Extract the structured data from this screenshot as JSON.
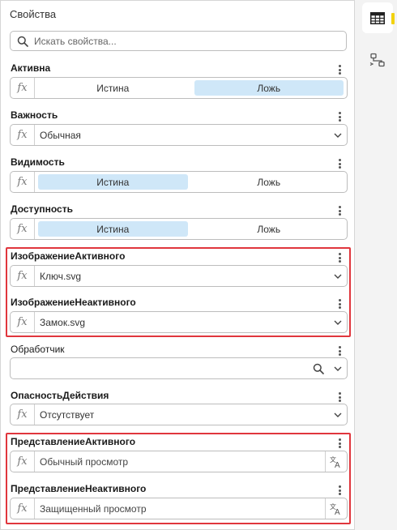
{
  "panel": {
    "title": "Свойства",
    "search_placeholder": "Искать свойства..."
  },
  "props": {
    "active": {
      "label": "Активна",
      "options": [
        "Истина",
        "Ложь"
      ],
      "selected": "Ложь"
    },
    "importance": {
      "label": "Важность",
      "value": "Обычная"
    },
    "visibility": {
      "label": "Видимость",
      "options": [
        "Истина",
        "Ложь"
      ],
      "selected": "Истина"
    },
    "accessibility": {
      "label": "Доступность",
      "options": [
        "Истина",
        "Ложь"
      ],
      "selected": "Истина"
    },
    "active_image": {
      "label": "ИзображениеАктивного",
      "value": "Ключ.svg"
    },
    "inactive_image": {
      "label": "ИзображениеНеактивного",
      "value": "Замок.svg"
    },
    "handler": {
      "label": "Обработчик",
      "value": ""
    },
    "action_danger": {
      "label": "ОпасностьДействия",
      "value": "Отсутствует"
    },
    "active_view": {
      "label": "ПредставлениеАктивного",
      "value": "Обычный просмотр"
    },
    "inactive_view": {
      "label": "ПредставлениеНеактивного",
      "value": "Защищенный просмотр"
    }
  },
  "fx_label": "fx",
  "icons": {
    "search": "search-icon",
    "chevron": "chevron-down-icon",
    "more": "kebab-menu-icon",
    "translate": "translate-icon",
    "side_tab_1": "table-icon",
    "side_tab_2": "flow-diagram-icon"
  },
  "colors": {
    "highlight_border": "#e0363d",
    "selected_segment": "#cfe7f8",
    "active_tab_accent": "#f2d20f"
  }
}
